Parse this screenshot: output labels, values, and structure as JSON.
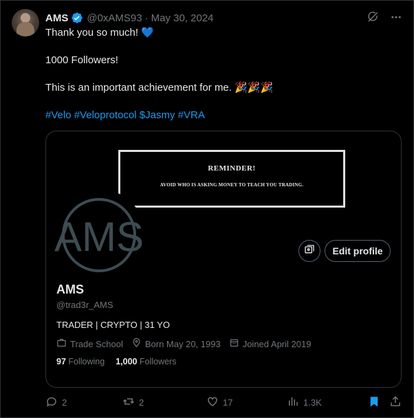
{
  "tweet": {
    "author_name": "AMS",
    "handle": "@0xAMS93",
    "separator": "·",
    "date": "May 30, 2024",
    "line1": "Thank you so much! 💙",
    "line2": "1000 Followers!",
    "line3": "This is an important achievement for me. 🎉🎉🎉",
    "hashtags": [
      "#Velo",
      "#Veloprotocol",
      "$Jasmy",
      "#VRA"
    ]
  },
  "card": {
    "banner_title": "REMINDER!",
    "banner_subtitle": "AVOID WHO IS ASKING MONEY TO TEACH YOU TRADING.",
    "logo_text": "AMS",
    "edit_profile_label": "Edit profile",
    "profile_name": "AMS",
    "profile_handle": "@trad3r_AMS",
    "bio": "TRADER | CRYPTO | 31 YO",
    "category": "Trade School",
    "born": "Born May 20, 1993",
    "joined": "Joined April 2019",
    "following_count": "97",
    "following_label": "Following",
    "followers_count": "1,000",
    "followers_label": "Followers"
  },
  "actions": {
    "replies": "2",
    "reposts": "2",
    "likes": "17",
    "views": "1.3K"
  },
  "colors": {
    "background": "#000000",
    "link": "#1d9bf0",
    "muted": "#71767b",
    "text": "#e7e9ea",
    "border": "#2f3336",
    "logo": "#3d4c52"
  },
  "icons": [
    "verified-badge-icon",
    "grok-icon",
    "more-icon",
    "briefcase-icon",
    "location-icon",
    "calendar-icon",
    "reply-icon",
    "repost-icon",
    "like-icon",
    "views-icon",
    "bookmark-icon",
    "share-icon",
    "media-icon"
  ]
}
